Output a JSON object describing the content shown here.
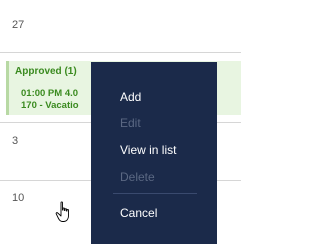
{
  "calendar": {
    "days": {
      "d27": "27",
      "d3": "3",
      "d10": "10"
    },
    "event": {
      "title": "Approved (1)",
      "time": "01:00 PM 4.0",
      "type": "170 - Vacatio"
    }
  },
  "context_menu": {
    "items": [
      {
        "label": "Add",
        "enabled": true
      },
      {
        "label": "Edit",
        "enabled": false
      },
      {
        "label": "View in list",
        "enabled": true
      },
      {
        "label": "Delete",
        "enabled": false
      },
      {
        "label": "Cancel",
        "enabled": true
      }
    ]
  },
  "colors": {
    "menu_bg": "#1b2a4a",
    "event_text": "#3a8a1f",
    "event_bg": "#e8f5e1"
  },
  "icons": {
    "cursor": "hand-pointer-icon"
  }
}
